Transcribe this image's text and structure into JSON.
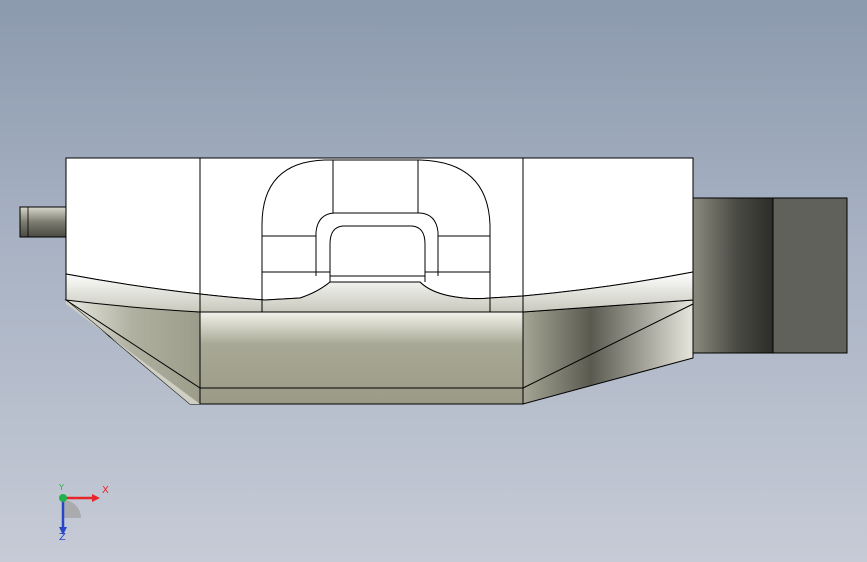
{
  "viewport": {
    "background_top": "#8c9aae",
    "background_bottom": "#c6cbd6"
  },
  "triad": {
    "x_label": "X",
    "y_label": "Y",
    "z_label": "Z",
    "x_color": "#e8262a",
    "y_color": "#22b14c",
    "z_color": "#2a46c8"
  },
  "model": {
    "name": "extruded-part",
    "face_color_light": "#ffffff",
    "face_color_dark": "#9a9a86",
    "edge_color": "#000000"
  }
}
